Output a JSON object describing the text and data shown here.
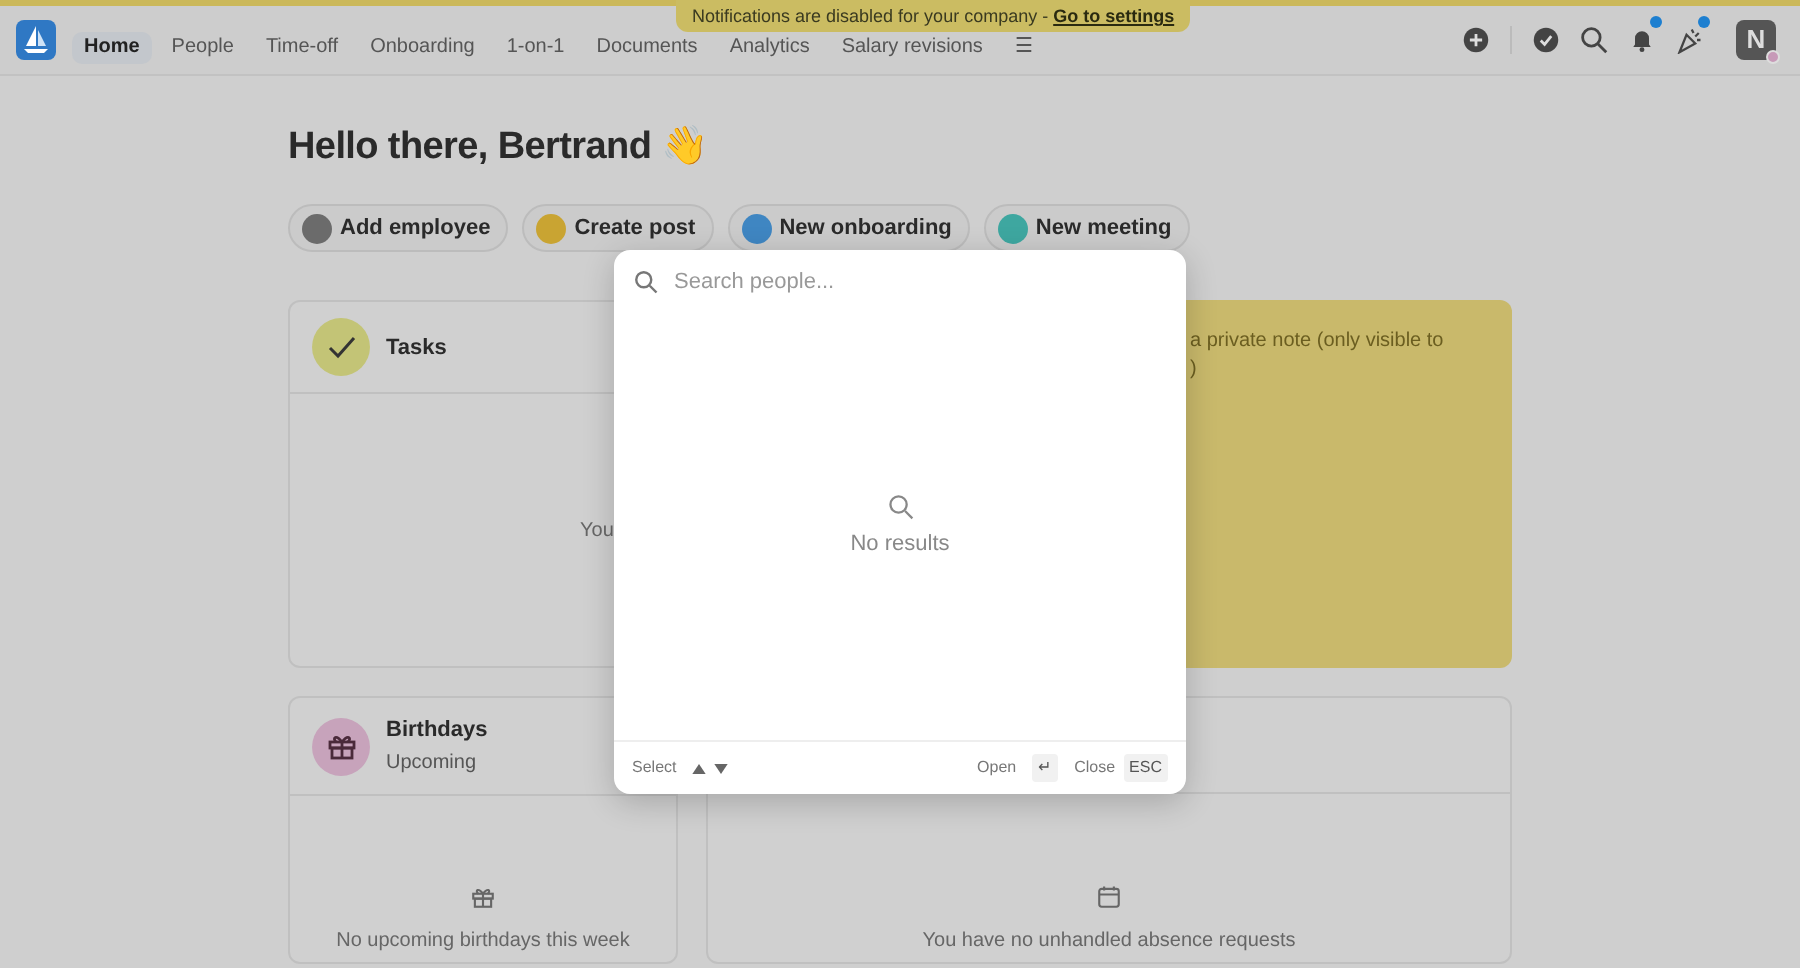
{
  "banner": {
    "text": "Notifications are disabled for your company - ",
    "link": "Go to settings"
  },
  "nav": [
    {
      "label": "Home",
      "selected": true
    },
    {
      "label": "People",
      "selected": false
    },
    {
      "label": "Time-off",
      "selected": false
    },
    {
      "label": "Onboarding",
      "selected": false
    },
    {
      "label": "1-on-1",
      "selected": false
    },
    {
      "label": "Documents",
      "selected": false
    },
    {
      "label": "Analytics",
      "selected": false
    },
    {
      "label": "Salary revisions",
      "selected": false
    }
  ],
  "nav_more": "☰",
  "top_icons": [
    {
      "kind": "plus",
      "dot": false
    },
    {
      "kind": "divider",
      "dot": false
    },
    {
      "kind": "check",
      "dot": false
    },
    {
      "kind": "search",
      "dot": false
    },
    {
      "kind": "bell",
      "dot": true
    },
    {
      "kind": "party",
      "dot": true
    }
  ],
  "avatar": {
    "initial": "N"
  },
  "greeting": "Hello there, Bertrand 👋",
  "actions": [
    {
      "label": "Add employee",
      "color": "#6b6b6b"
    },
    {
      "label": "Create post",
      "color": "#c9a432"
    },
    {
      "label": "New onboarding",
      "color": "#3f86c2"
    },
    {
      "label": "New meeting",
      "color": "#3ea7a0"
    }
  ],
  "tasks": {
    "title": "Tasks",
    "text": "You"
  },
  "note": {
    "lines": [
      "a private note (only visible to",
      ")"
    ]
  },
  "birthdays": {
    "title": "Birthdays",
    "subtitle": "Upcoming",
    "empty": "No upcoming birthdays this week"
  },
  "absence": {
    "empty": "You have no unhandled absence requests"
  },
  "search_modal": {
    "placeholder": "Search people...",
    "empty": "No results",
    "footer": {
      "select": "Select",
      "open": "Open",
      "open_key": "↵",
      "close": "Close",
      "close_key": "ESC"
    }
  }
}
